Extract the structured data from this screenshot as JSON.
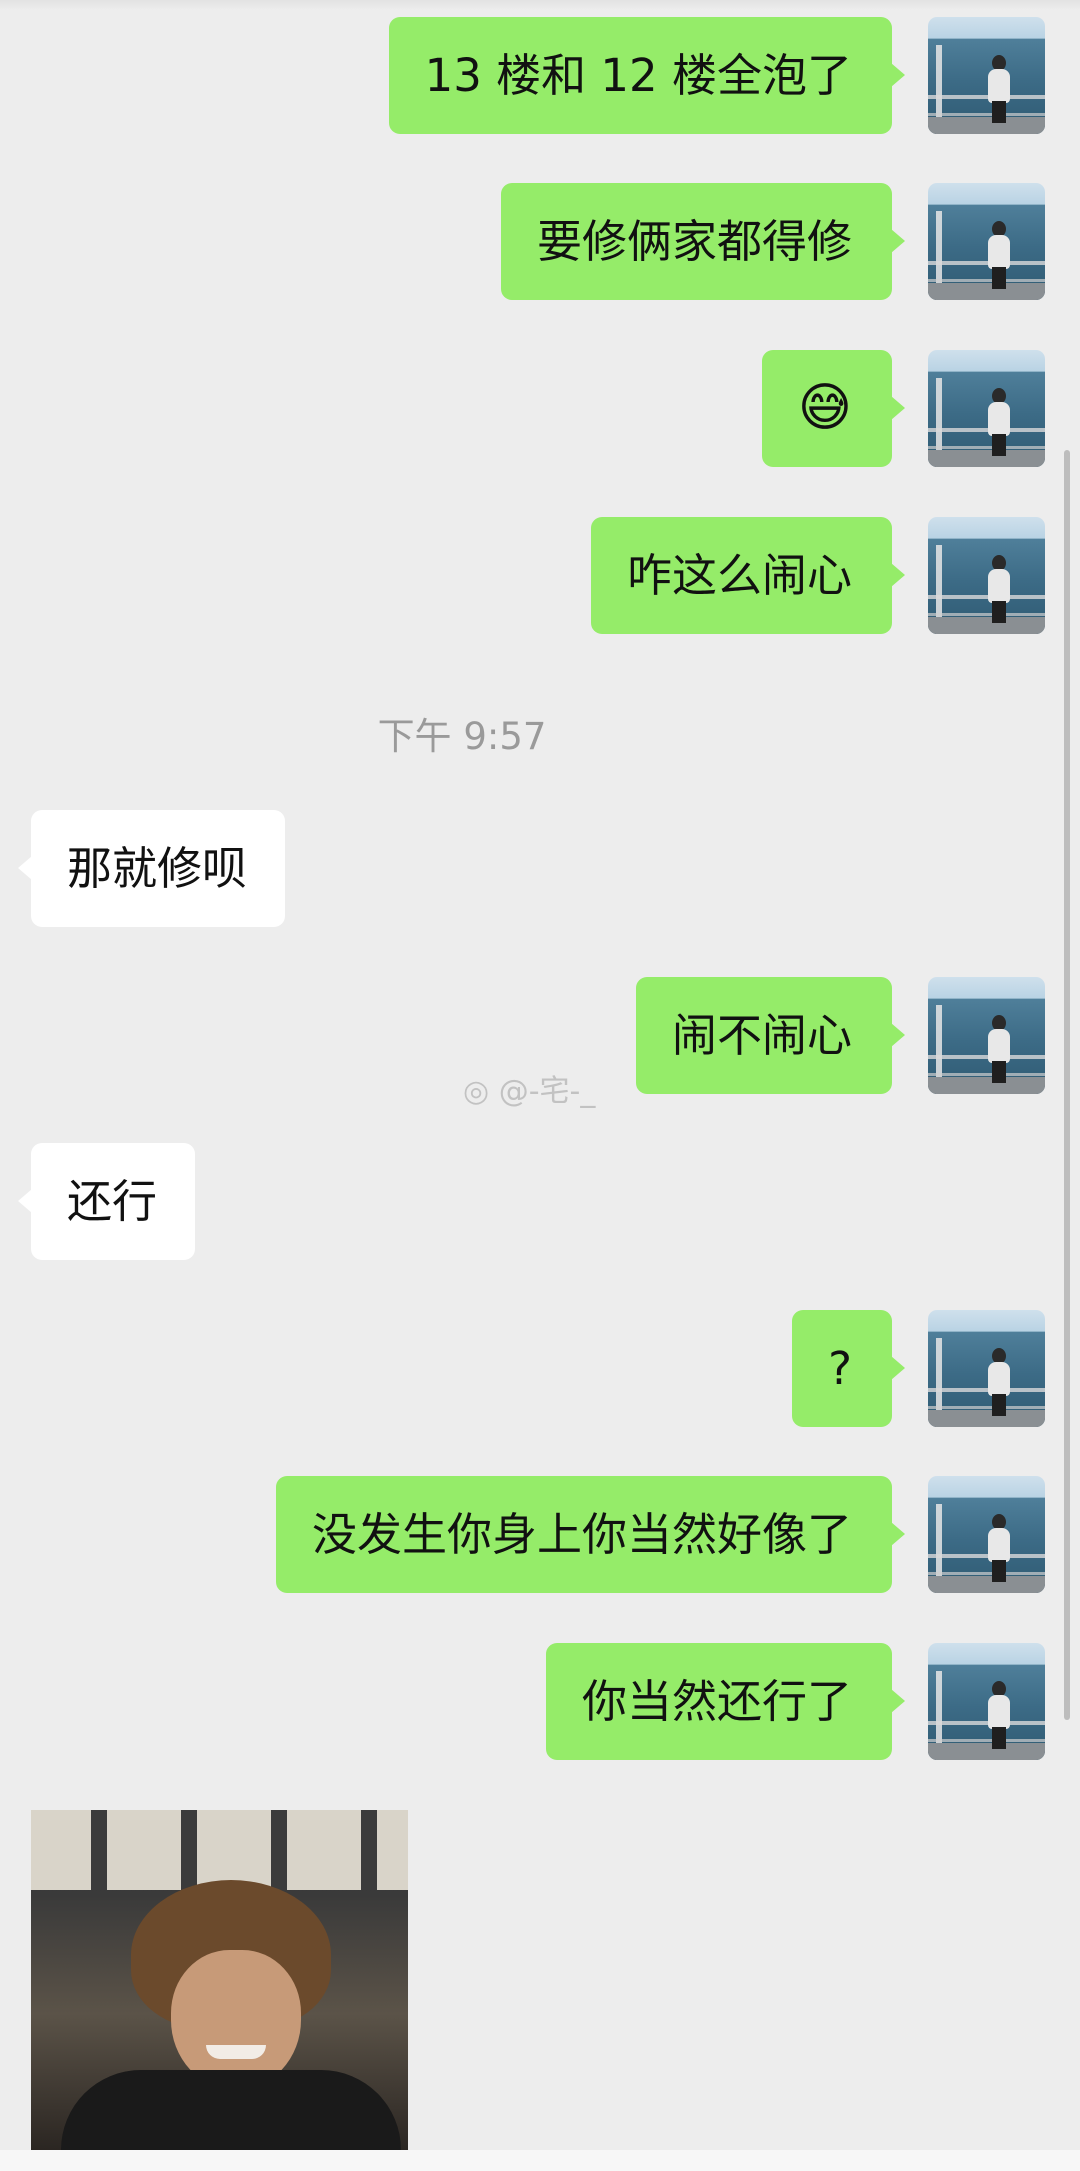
{
  "messages": [
    {
      "side": "out",
      "text": "13 楼和 12 楼全泡了"
    },
    {
      "side": "out",
      "text": "要修俩家都得修"
    },
    {
      "side": "out",
      "text": "😅"
    },
    {
      "side": "out",
      "text": "咋这么闹心"
    },
    {
      "side": "in",
      "text": "那就修呗"
    },
    {
      "side": "out",
      "text": "闹不闹心"
    },
    {
      "side": "in",
      "text": "还行"
    },
    {
      "side": "out",
      "text": "?"
    },
    {
      "side": "out",
      "text": "没发生你身上你当然好像了"
    },
    {
      "side": "out",
      "text": "你当然还行了"
    }
  ],
  "timestamp": "下午 9:57",
  "watermark": "@-宅-_",
  "icons": {
    "avatar": "user-avatar-photo",
    "sticker": "grinning-man-sticker",
    "emoji": "sweat-smile-emoji",
    "watermark_logo": "weibo-logo"
  },
  "colors": {
    "background": "#ededed",
    "outgoing_bubble": "#95ec69",
    "incoming_bubble": "#ffffff",
    "timestamp_text": "#9a9a9a"
  }
}
